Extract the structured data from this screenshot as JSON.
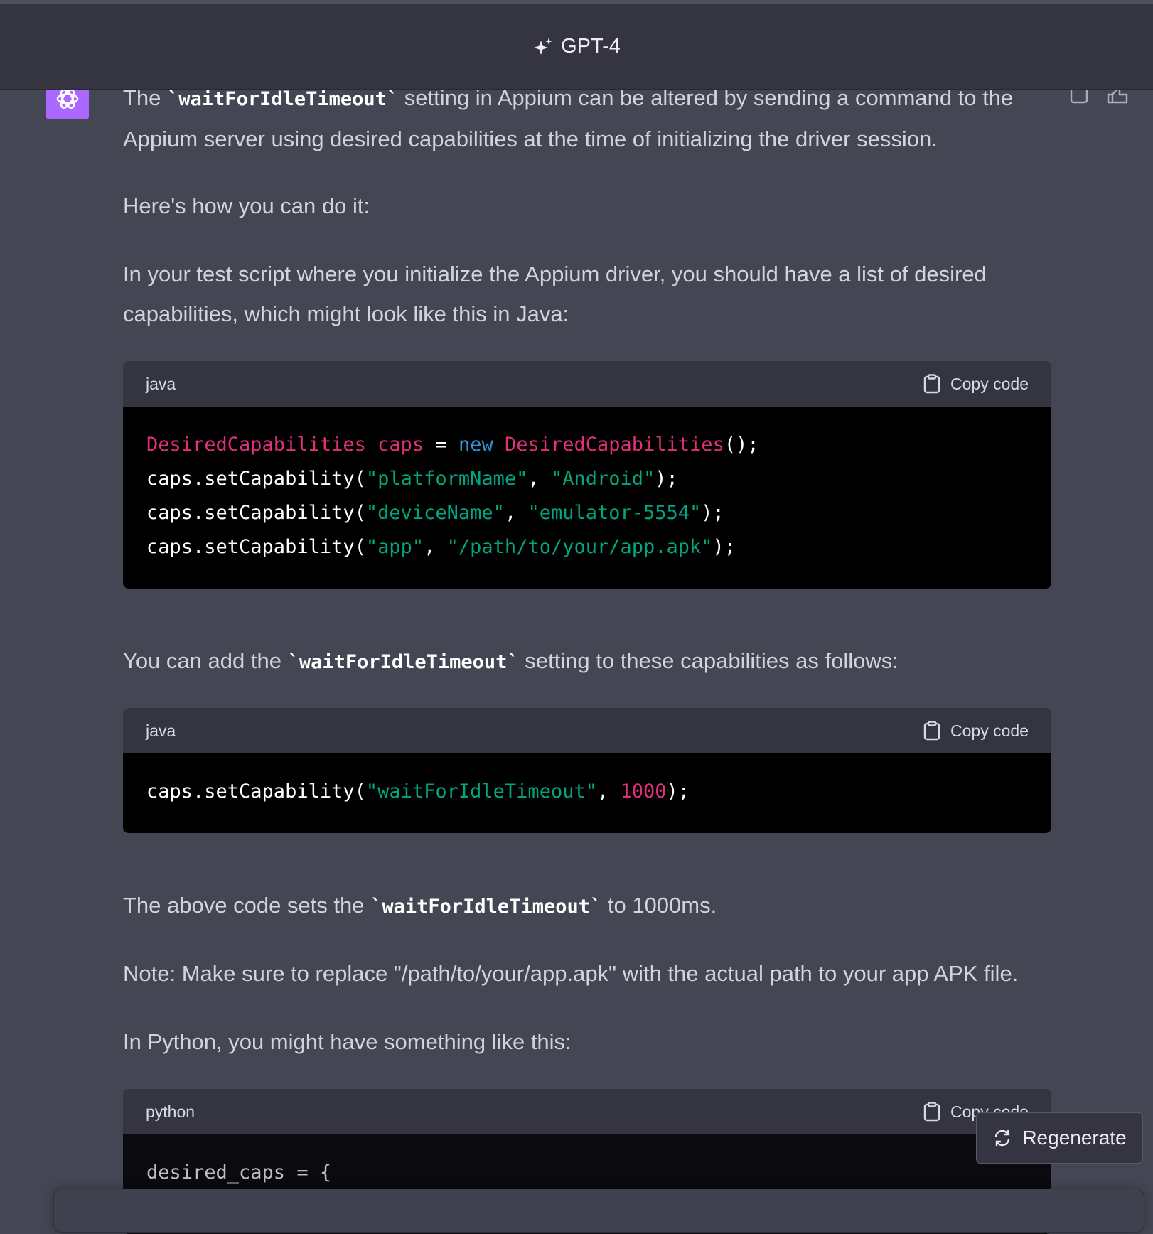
{
  "header": {
    "model_label": "GPT-4"
  },
  "message": {
    "p1_before": "The ",
    "p1_code": "`waitForIdleTimeout`",
    "p1_after": " setting in Appium can be altered by sending a command to the Appium server using desired capabilities at the time of initializing the driver session.",
    "p2": "Here's how you can do it:",
    "p3": "In your test script where you initialize the Appium driver, you should have a list of desired capabilities, which might look like this in Java:",
    "p4_before": "You can add the ",
    "p4_code": "`waitForIdleTimeout`",
    "p4_after": " setting to these capabilities as follows:",
    "p5_before": "The above code sets the ",
    "p5_code": "`waitForIdleTimeout`",
    "p5_after": " to 1000ms.",
    "p6": "Note: Make sure to replace \"/path/to/your/app.apk\" with the actual path to your app APK file.",
    "p7": "In Python, you might have something like this:"
  },
  "code_blocks": [
    {
      "language": "java",
      "copy_label": "Copy code",
      "lines": [
        [
          "DesiredCapabilities",
          " ",
          "caps",
          " = ",
          "new",
          " ",
          "DesiredCapabilities",
          "();"
        ],
        [
          "caps.setCapability(",
          "\"platformName\"",
          ", ",
          "\"Android\"",
          ");"
        ],
        [
          "caps.setCapability(",
          "\"deviceName\"",
          ", ",
          "\"emulator-5554\"",
          ");"
        ],
        [
          "caps.setCapability(",
          "\"app\"",
          ", ",
          "\"/path/to/your/app.apk\"",
          ");"
        ]
      ]
    },
    {
      "language": "java",
      "copy_label": "Copy code",
      "lines": [
        [
          "caps.setCapability(",
          "\"waitForIdleTimeout\"",
          ", ",
          "1000",
          ");"
        ]
      ]
    },
    {
      "language": "python",
      "copy_label": "Copy code",
      "lines": [
        [
          "desired_caps = {"
        ]
      ]
    }
  ],
  "regenerate_label": "Regenerate"
}
